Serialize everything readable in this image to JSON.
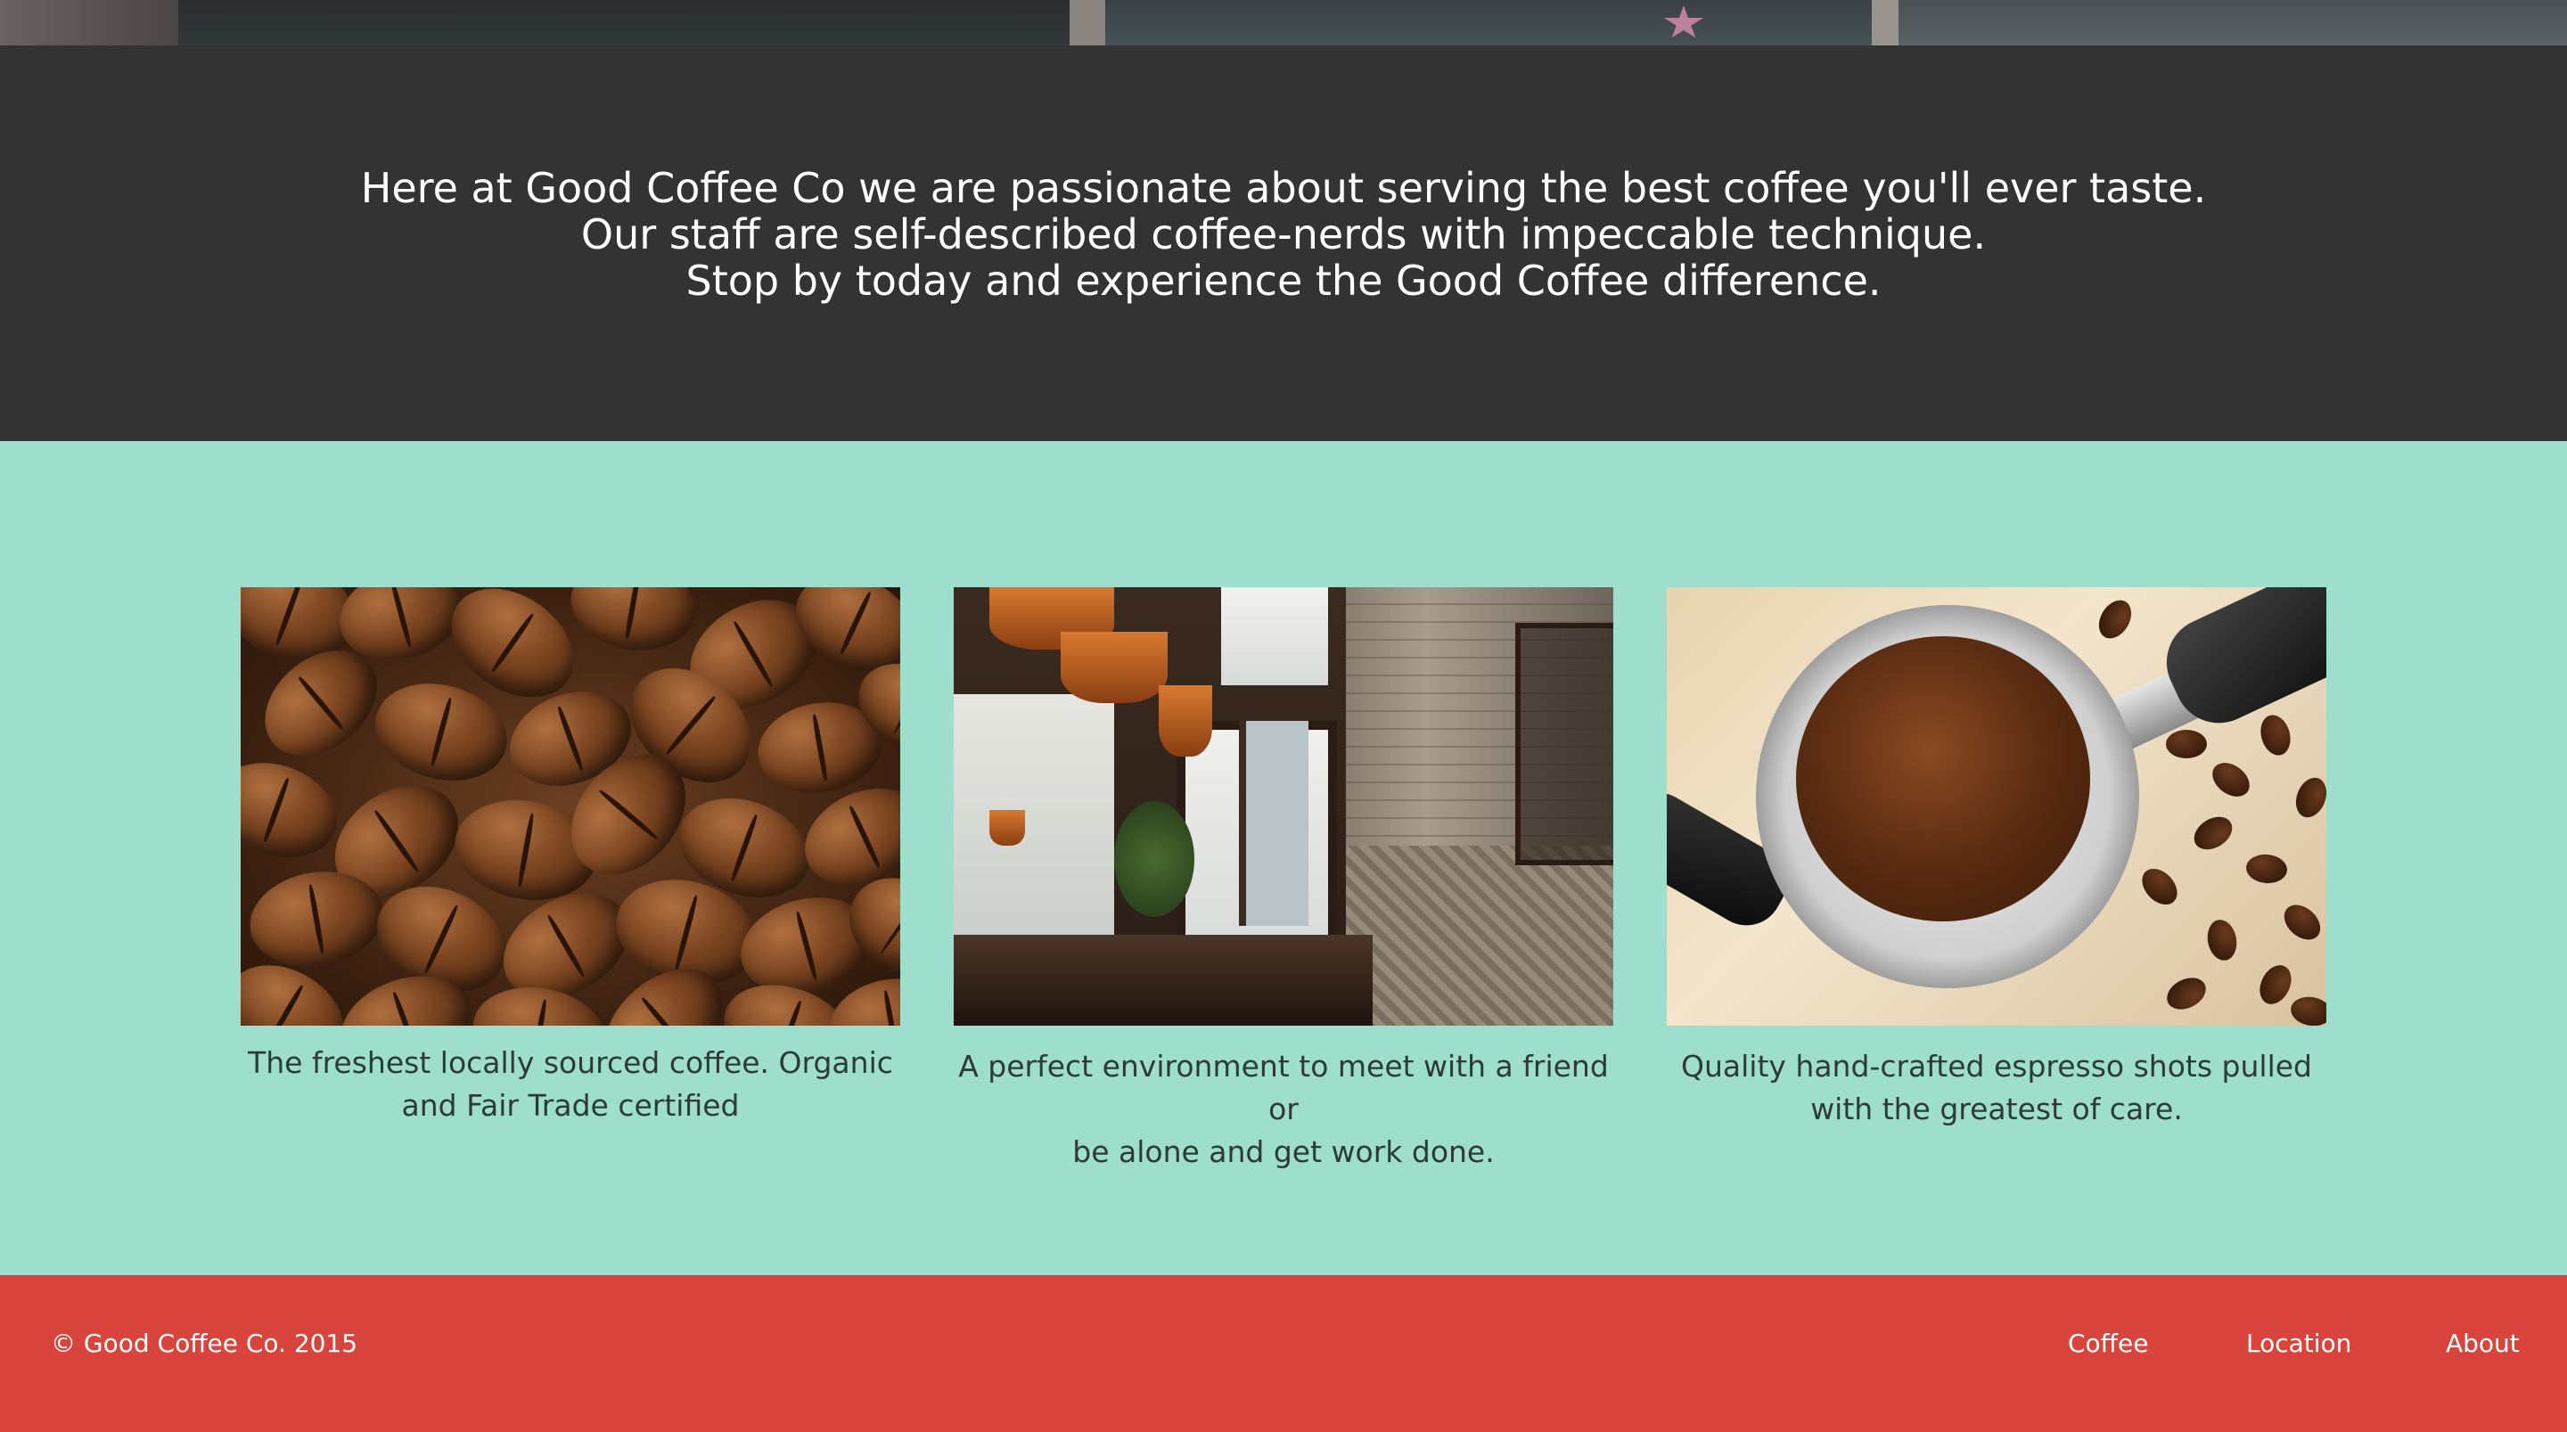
{
  "intro": {
    "lines": [
      "Here at Good Coffee Co we are passionate about serving the best coffee you'll ever taste.",
      "Our staff are self-described coffee-nerds with impeccable technique.",
      "Stop by today and experience the Good Coffee difference."
    ]
  },
  "features": [
    {
      "image": "coffee-beans",
      "caption_lines": [
        "The freshest locally sourced coffee. Organic",
        "and Fair Trade certified"
      ]
    },
    {
      "image": "cafe-interior",
      "caption_lines": [
        "A perfect environment to meet with a friend or",
        "be alone and get work done."
      ]
    },
    {
      "image": "espresso-portafilter",
      "caption_lines": [
        "Quality hand-crafted espresso shots pulled",
        "with the greatest of care."
      ]
    }
  ],
  "footer": {
    "copyright": "© Good Coffee Co. 2015",
    "nav": [
      "Coffee",
      "Location",
      "About"
    ]
  },
  "colors": {
    "intro_bg": "#333333",
    "features_bg": "#9ddecd",
    "footer_bg": "#d9443c"
  }
}
